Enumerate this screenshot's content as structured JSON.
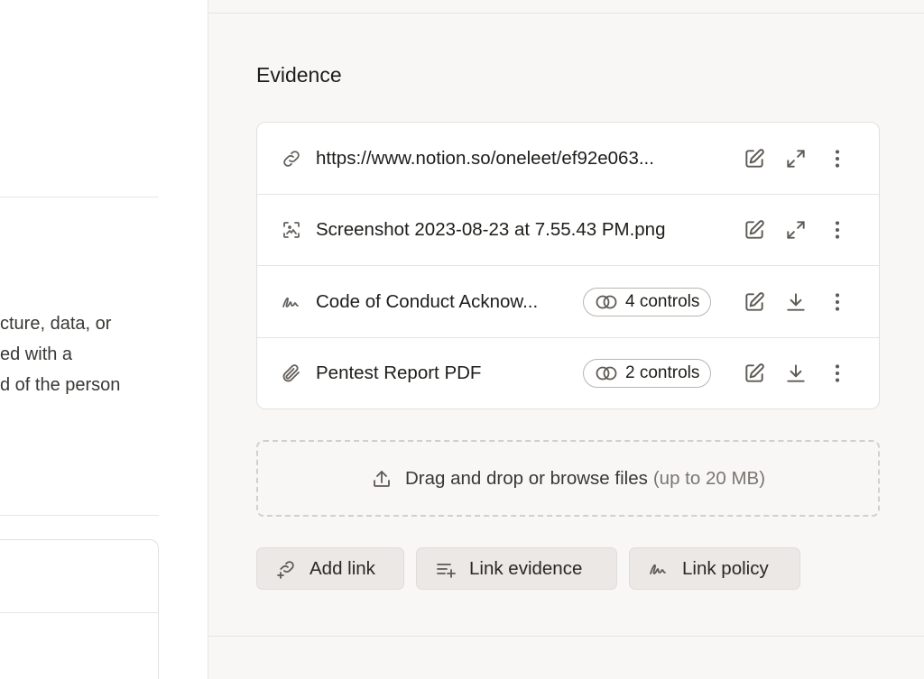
{
  "left_panel": {
    "text_lines": [
      "cture, data, or",
      "ed with a",
      "d of the person"
    ]
  },
  "evidence": {
    "title": "Evidence",
    "items": [
      {
        "icon": "link-icon",
        "title": "https://www.notion.so/oneleet/ef92e063...",
        "badge": "",
        "action": "expand-icon"
      },
      {
        "icon": "screenshot-icon",
        "title": "Screenshot 2023-08-23 at 7.55.43 PM.png",
        "badge": "",
        "action": "expand-icon"
      },
      {
        "icon": "signature-icon",
        "title": "Code of Conduct Acknow...",
        "badge": "4 controls",
        "action": "download-icon"
      },
      {
        "icon": "paperclip-icon",
        "title": "Pentest Report PDF",
        "badge": "2 controls",
        "action": "download-icon"
      }
    ]
  },
  "dropzone": {
    "label": "Drag and drop or browse files",
    "limit": "(up to 20 MB)"
  },
  "buttons": {
    "add_link": "Add link",
    "link_evidence": "Link evidence",
    "link_policy": "Link policy"
  }
}
